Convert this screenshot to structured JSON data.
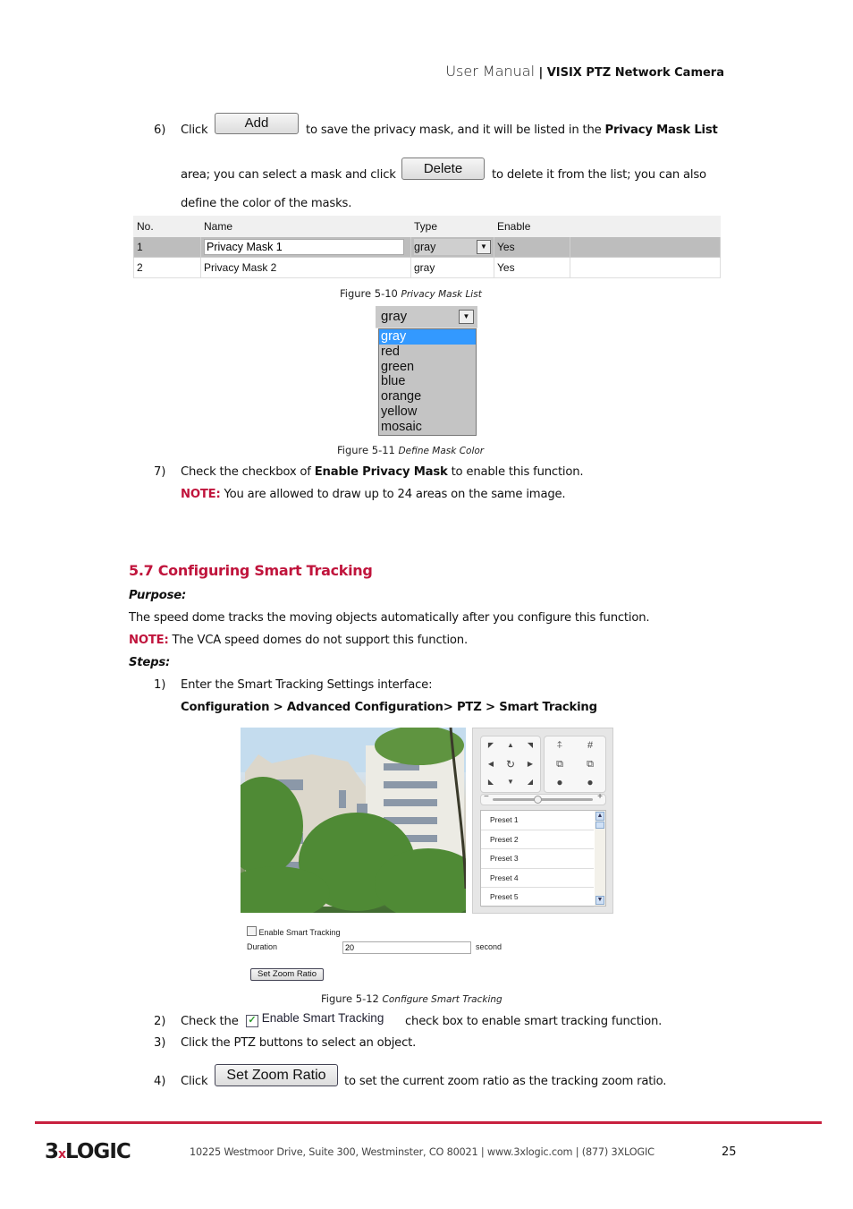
{
  "header": {
    "title_light": "User Manual",
    "separator": "|",
    "title_bold": "VISIX PTZ Network Camera"
  },
  "step6": {
    "number": "6)",
    "text_click": "Click",
    "add_button": "Add",
    "text_after_add": "to save the privacy mask, and it will be listed in the",
    "bold_list": "Privacy Mask List",
    "text_area": "area; you can select a mask and click",
    "delete_button": "Delete",
    "text_after_delete": "to delete it from the list; you can also",
    "text_define": "define the color of the masks."
  },
  "privacy_table": {
    "headers": [
      "No.",
      "Name",
      "Type",
      "Enable"
    ],
    "rows": [
      {
        "no": "1",
        "name": "Privacy Mask 1",
        "type": "gray",
        "enable": "Yes"
      },
      {
        "no": "2",
        "name": "Privacy Mask 2",
        "type": "gray",
        "enable": "Yes"
      }
    ]
  },
  "fig510": {
    "label": "Figure 5-10",
    "title": "Privacy Mask List"
  },
  "color_dropdown": {
    "selected": "gray",
    "options": [
      "gray",
      "red",
      "green",
      "blue",
      "orange",
      "yellow",
      "mosaic"
    ],
    "highlighted": "gray"
  },
  "fig511": {
    "label": "Figure 5-11",
    "title": "Define Mask Color"
  },
  "step7": {
    "number": "7)",
    "text_a": "Check the checkbox of",
    "bold": "Enable Privacy Mask",
    "text_b": "to enable this function.",
    "note_label": "NOTE:",
    "note_text": "You are allowed to draw up to 24 areas on the same image."
  },
  "section": {
    "number": "5.7",
    "title": "Configuring Smart Tracking"
  },
  "purpose": {
    "label": "Purpose:",
    "text": "The speed dome tracks the moving objects automatically after you configure this function.",
    "note_label": "NOTE:",
    "note_text": "The VCA speed domes do not support this function."
  },
  "steps": {
    "label": "Steps:",
    "step1_number": "1)",
    "step1_text": "Enter the Smart Tracking Settings interface:",
    "step1_path": "Configuration > Advanced Configuration> PTZ > Smart Tracking"
  },
  "ptz_panel": {
    "direction_buttons": [
      "up-left",
      "up",
      "up-right",
      "left",
      "auto-pan",
      "right",
      "down-left",
      "down",
      "down-right"
    ],
    "zoom_slider_minus": "−",
    "zoom_slider_plus": "+",
    "zoom_slider_value": 0.45,
    "presets": [
      "Preset 1",
      "Preset 2",
      "Preset 3",
      "Preset 4",
      "Preset 5"
    ]
  },
  "smart_tracking_form": {
    "enable_label": "Enable Smart Tracking",
    "enable_checked": false,
    "duration_label": "Duration",
    "duration_value": "20",
    "duration_unit": "second",
    "set_zoom_button": "Set Zoom Ratio"
  },
  "fig512": {
    "label": "Figure 5-12",
    "title": "Configure Smart Tracking"
  },
  "step2": {
    "number": "2)",
    "text_a": "Check the",
    "checkbox_label": "Enable Smart Tracking",
    "text_b": "check box to enable smart tracking function."
  },
  "step3": {
    "number": "3)",
    "text": "Click the PTZ buttons to select an object."
  },
  "step4": {
    "number": "4)",
    "text_a": "Click",
    "button": "Set Zoom Ratio",
    "text_b": "to set the current zoom ratio as the tracking zoom ratio."
  },
  "footer": {
    "logo_a": "3",
    "logo_x": "x",
    "logo_b": "LOGIC",
    "address": "10225 Westmoor Drive, Suite 300, Westminster, CO 80021 | www.3xlogic.com | (877) 3XLOGIC",
    "page_number": "25",
    "accent_color": "#c8203f"
  }
}
